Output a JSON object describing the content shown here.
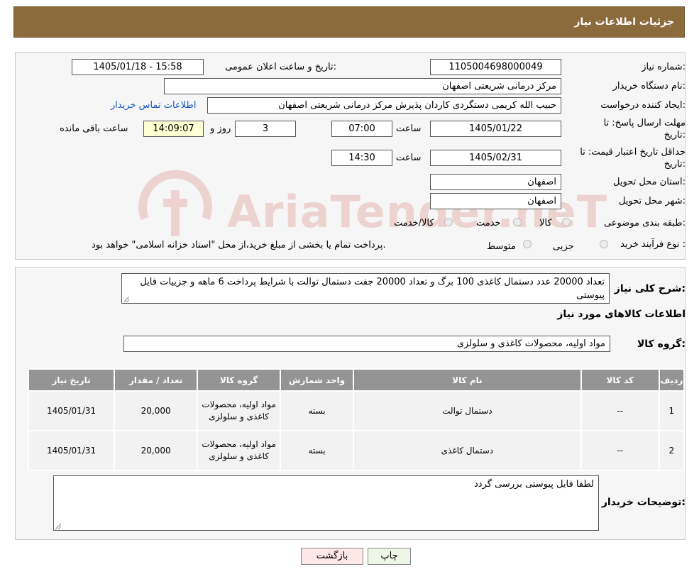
{
  "header": {
    "title": "جزئیات اطلاعات نیاز"
  },
  "form": {
    "need_number_label": "شماره نیاز:",
    "need_number": "1105004698000049",
    "announce_label": "تاریخ و ساعت اعلان عمومی:",
    "announce_value": "1405/01/18 - 15:58",
    "buyer_org_label": "نام دستگاه خریدار:",
    "buyer_org": "مرکز درمانی شریعتی اصفهان",
    "creator_label": "ایجاد کننده درخواست:",
    "creator": "حبیب الله کریمی دستگردی کاردان پذیرش مرکز درمانی شریعتی اصفهان",
    "contact_link": "اطلاعات تماس خریدار",
    "reply_deadline_label_1": "مهلت ارسال پاسخ: تا",
    "reply_deadline_label_2": "تاریخ:",
    "reply_date": "1405/01/22",
    "time_label": "ساعت",
    "reply_time": "07:00",
    "days_value": "3",
    "days_label": "روز و",
    "remaining_time": "14:09:07",
    "remaining_label": "ساعت باقی مانده",
    "price_validity_label_1": "حداقل تاریخ اعتبار قیمت: تا",
    "price_validity_label_2": "تاریخ:",
    "price_date": "1405/02/31",
    "price_time": "14:30",
    "province_label": "استان محل تحویل:",
    "province": "اصفهان",
    "city_label": "شهر محل تحویل:",
    "city": "اصفهان",
    "category_label": "طبقه بندی موضوعی:",
    "category_options": [
      "کالا",
      "خدمت",
      "کالا/خدمت"
    ],
    "process_label": "نوع فرآیند خرید :",
    "process_options": [
      "جزیی",
      "متوسط"
    ],
    "process_note": "پرداخت تمام یا بخشی از مبلغ خرید،از محل \"اسناد خزانه اسلامی\" خواهد بود."
  },
  "description": {
    "label": "شرح کلی نیاز:",
    "text": "تعداد 20000 عدد دستمال کاغذی 100 برگ و تعداد 20000 جفت دستمال توالت با شرایط پرداخت 6 ماهه و جزییات فایل پیوستی",
    "items_heading": "اطلاعات کالاهای مورد نیاز",
    "group_label": "گروه کالا:",
    "group_value": "مواد اولیه، محصولات کاغذی و سلولزی"
  },
  "table": {
    "headers": [
      "ردیف",
      "کد کالا",
      "نام کالا",
      "واحد شمارش",
      "گروه کالا",
      "تعداد / مقدار",
      "تاریخ نیاز"
    ],
    "rows": [
      [
        "1",
        "--",
        "دستمال توالت",
        "بسته",
        "مواد اولیه، محصولات کاغذی و سلولزی",
        "20,000",
        "1405/01/31"
      ],
      [
        "2",
        "--",
        "دستمال کاغذی",
        "بسته",
        "مواد اولیه، محصولات کاغذی و سلولزی",
        "20,000",
        "1405/01/31"
      ]
    ]
  },
  "notes": {
    "label": "توضیحات خریدار:",
    "text": "لطفا فایل پیوستی بررسی گردد"
  },
  "buttons": {
    "print": "چاپ",
    "back": "بازگشت"
  },
  "watermark": {
    "text": "AriaTender.neT"
  },
  "colors": {
    "header_bg": "#8b6a3c",
    "table_header_bg": "#949494",
    "back_button_bg": "#fde7e7",
    "print_button_bg": "#eef6e8",
    "link": "#1a56c6"
  }
}
